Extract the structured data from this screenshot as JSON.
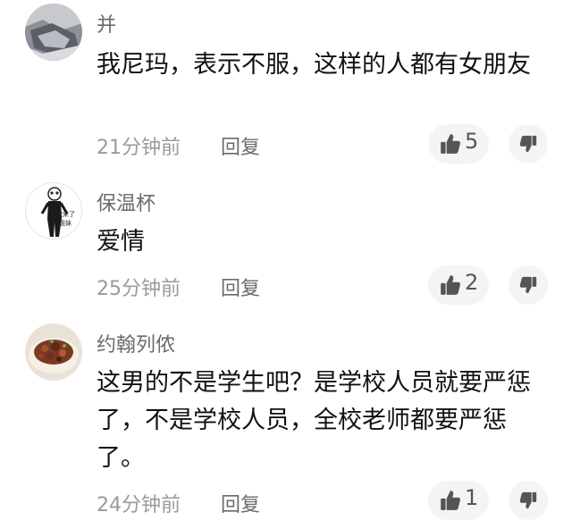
{
  "comments": [
    {
      "username": "并",
      "text": "我尼玛，表示不服，这样的人都有女朋友",
      "time": "21分钟前",
      "reply_label": "回复",
      "likes": "5",
      "avatar_icon": "grey-photo-avatar"
    },
    {
      "username": "保温杯",
      "text": "爱情",
      "time": "25分钟前",
      "reply_label": "回复",
      "likes": "2",
      "avatar_icon": "panda-meme-avatar",
      "avatar_caption_line1": "我来了",
      "avatar_caption_line2": "姐妹"
    },
    {
      "username": "约翰列侬",
      "text": "这男的不是学生吧？是学校人员就要严惩了，不是学校人员，全校老师都要严惩了。",
      "time": "24分钟前",
      "reply_label": "回复",
      "likes": "1",
      "avatar_icon": "food-photo-avatar"
    }
  ],
  "colors": {
    "username": "#6b6b6b",
    "body_text": "#111111",
    "time": "#9a9a9a",
    "button_bg": "#f4f4f4",
    "icon": "#555555"
  }
}
